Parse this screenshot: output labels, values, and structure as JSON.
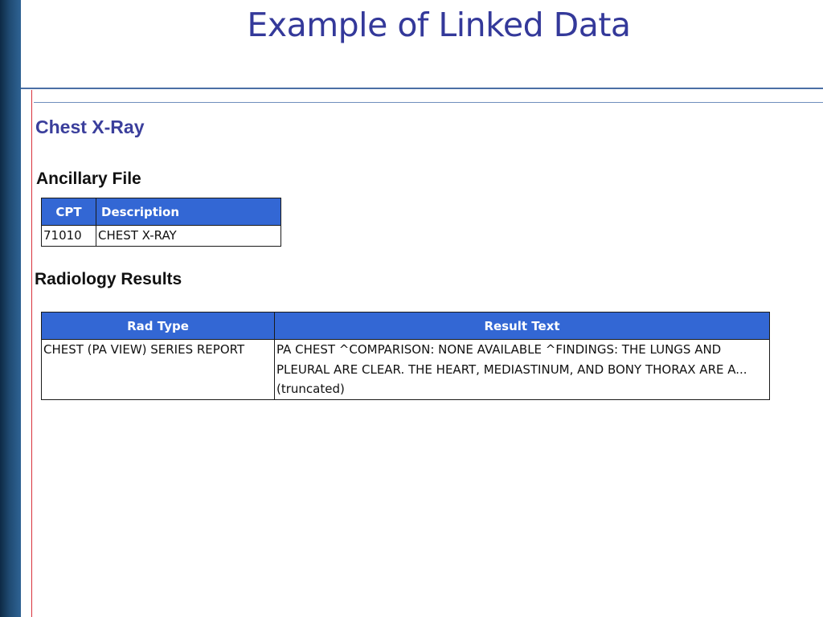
{
  "slide": {
    "title": "Example of Linked Data",
    "subtitle": "Chest X-Ray"
  },
  "ancillary": {
    "heading": "Ancillary File",
    "columns": [
      "CPT",
      "Description"
    ],
    "rows": [
      {
        "cpt": "71010",
        "description": "CHEST X-RAY"
      }
    ]
  },
  "radiology": {
    "heading": "Radiology Results",
    "columns": [
      "Rad Type",
      "Result Text"
    ],
    "rows": [
      {
        "rad_type": "CHEST (PA VIEW) SERIES REPORT",
        "result_text": "PA CHEST ^COMPARISON: NONE AVAILABLE ^FINDINGS:  THE LUNGS AND PLEURAL ARE CLEAR.  THE HEART, MEDIASTINUM, AND BONY THORAX ARE A... (truncated)"
      }
    ]
  },
  "colors": {
    "title": "#34399a",
    "header_fill": "#3367d4",
    "accent_line": "#d8323c",
    "rule": "#4a6fa5",
    "left_bar": "#1f4a72"
  }
}
